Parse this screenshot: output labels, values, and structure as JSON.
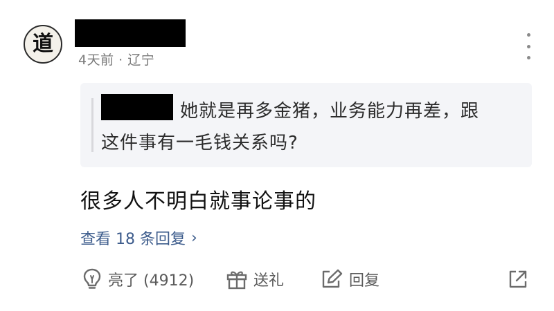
{
  "comment": {
    "avatar_glyph": "道",
    "meta": "4天前 · 辽宁",
    "quote": {
      "line1": "她就是再多金猪，业务能力再差，跟",
      "line2": "这件事有一毛钱关系吗?"
    },
    "text": "很多人不明白就事论事的",
    "view_replies": "查看 18 条回复",
    "view_replies_chevron": "›"
  },
  "actions": {
    "like_label": "亮了 (4912)",
    "gift_label": "送礼",
    "reply_label": "回复"
  },
  "icons": [
    "lightbulb-icon",
    "gift-icon",
    "edit-reply-icon",
    "share-icon",
    "more-vertical-icon"
  ],
  "colors": {
    "link": "#3d5c8c",
    "meta": "#7a7a7a",
    "quote_bg": "#f4f5f8"
  }
}
